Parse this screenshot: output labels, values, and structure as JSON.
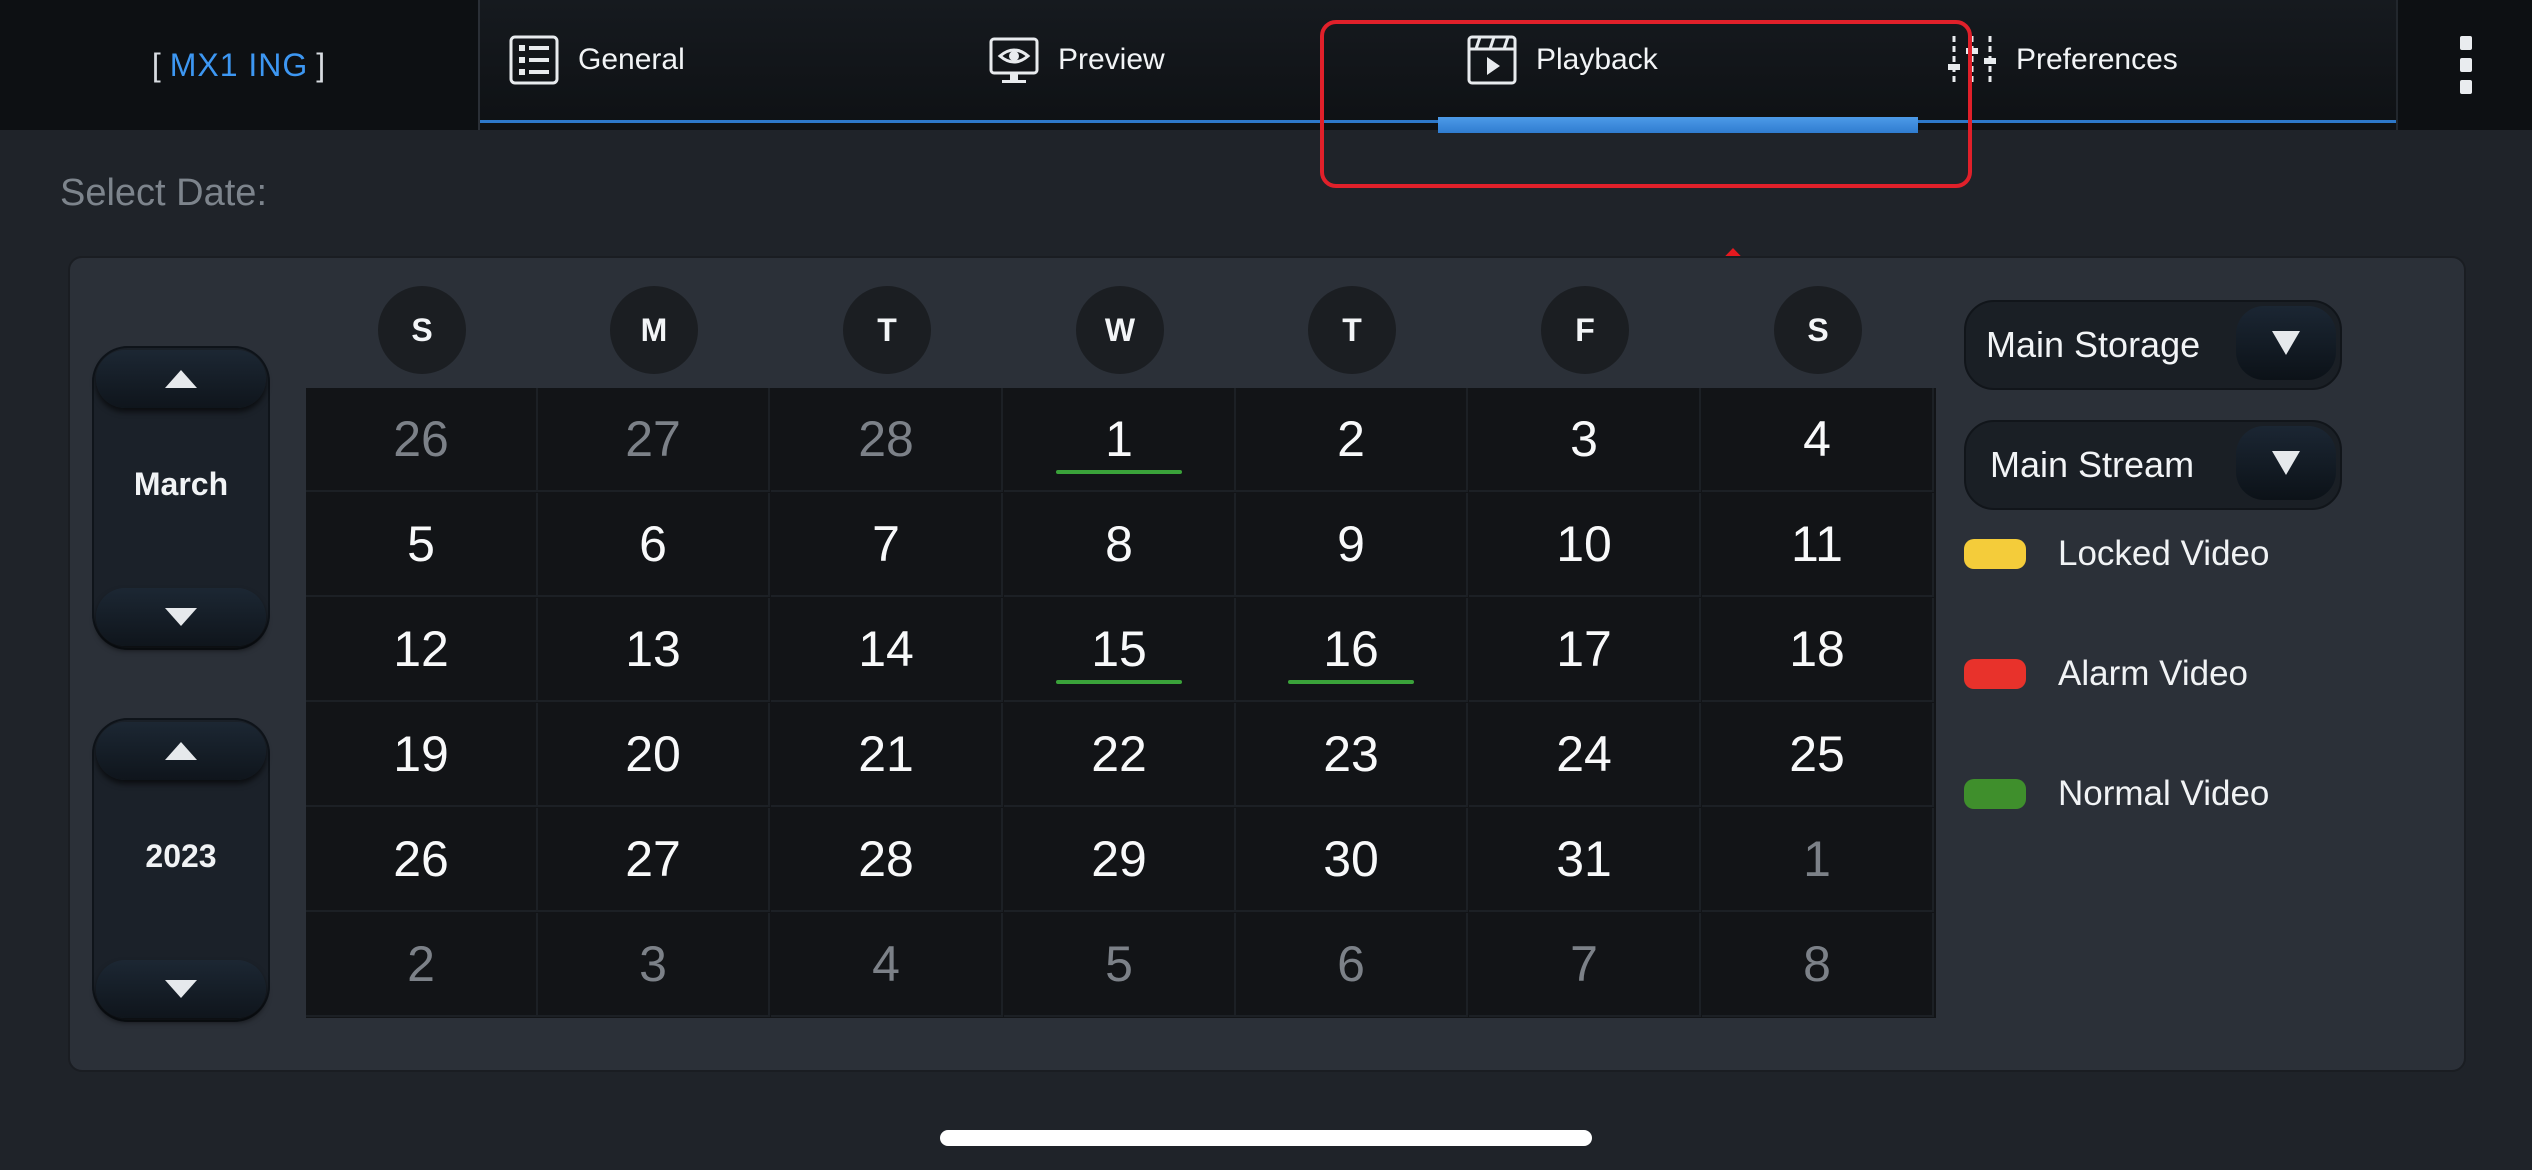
{
  "device": {
    "bracket_open": "[",
    "name": "MX1 ING",
    "bracket_close": "]"
  },
  "tabs": [
    {
      "label": "General",
      "icon": "settings-grid-icon"
    },
    {
      "label": "Preview",
      "icon": "monitor-eye-icon"
    },
    {
      "label": "Playback",
      "icon": "clapperboard-play-icon",
      "active": true
    },
    {
      "label": "Preferences",
      "icon": "sliders-icon"
    }
  ],
  "select_date_label": "Select Date:",
  "month": "March",
  "year": "2023",
  "weekdays": [
    "S",
    "M",
    "T",
    "W",
    "T",
    "F",
    "S"
  ],
  "calendar_rows": [
    [
      "26",
      "27",
      "28",
      "1",
      "2",
      "3",
      "4"
    ],
    [
      "5",
      "6",
      "7",
      "8",
      "9",
      "10",
      "11"
    ],
    [
      "12",
      "13",
      "14",
      "15",
      "16",
      "17",
      "18"
    ],
    [
      "19",
      "20",
      "21",
      "22",
      "23",
      "24",
      "25"
    ],
    [
      "26",
      "27",
      "28",
      "29",
      "30",
      "31",
      "1"
    ],
    [
      "2",
      "3",
      "4",
      "5",
      "6",
      "7",
      "8"
    ]
  ],
  "normal_video_days": [
    "1",
    "15",
    "16"
  ],
  "storage_dropdown": "Main Storage",
  "stream_dropdown": "Main Stream",
  "legend": [
    {
      "label": "Locked Video",
      "color": "#f4cc3a"
    },
    {
      "label": "Alarm Video",
      "color": "#e8322b"
    },
    {
      "label": "Normal Video",
      "color": "#3f8f2c"
    }
  ],
  "colors": {
    "accent": "#3d97f2",
    "highlight": "#e0202a",
    "normal_marker": "#3aa23a"
  }
}
